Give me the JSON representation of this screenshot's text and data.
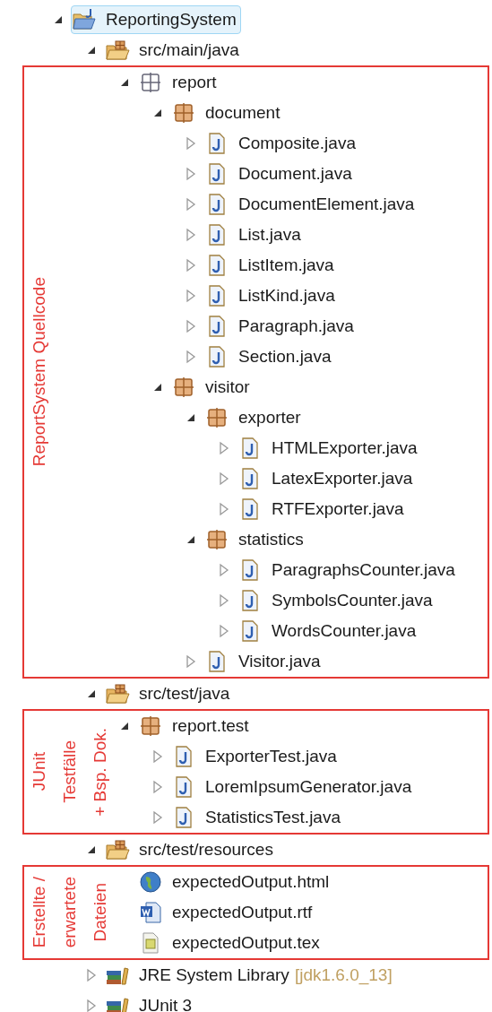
{
  "tree": [
    {
      "label": "ReportingSystem",
      "kind": "project",
      "expanded": true,
      "selected": true,
      "children": [
        {
          "label": "src/main/java",
          "kind": "source-folder",
          "expanded": true,
          "selected": false,
          "annotation": [
            "ReportSystem Quellcode"
          ],
          "children": [
            {
              "label": "report",
              "kind": "empty-package",
              "expanded": true,
              "selected": false,
              "children": [
                {
                  "label": "document",
                  "kind": "package",
                  "expanded": true,
                  "selected": false,
                  "children": [
                    {
                      "label": "Composite.java",
                      "kind": "java-file",
                      "expanded": false,
                      "selected": false
                    },
                    {
                      "label": "Document.java",
                      "kind": "java-file",
                      "expanded": false,
                      "selected": false
                    },
                    {
                      "label": "DocumentElement.java",
                      "kind": "java-file",
                      "expanded": false,
                      "selected": false
                    },
                    {
                      "label": "List.java",
                      "kind": "java-file",
                      "expanded": false,
                      "selected": false
                    },
                    {
                      "label": "ListItem.java",
                      "kind": "java-file",
                      "expanded": false,
                      "selected": false
                    },
                    {
                      "label": "ListKind.java",
                      "kind": "java-file",
                      "expanded": false,
                      "selected": false
                    },
                    {
                      "label": "Paragraph.java",
                      "kind": "java-file",
                      "expanded": false,
                      "selected": false
                    },
                    {
                      "label": "Section.java",
                      "kind": "java-file",
                      "expanded": false,
                      "selected": false
                    }
                  ]
                },
                {
                  "label": "visitor",
                  "kind": "package",
                  "expanded": true,
                  "selected": false,
                  "children": [
                    {
                      "label": "exporter",
                      "kind": "package",
                      "expanded": true,
                      "selected": false,
                      "children": [
                        {
                          "label": "HTMLExporter.java",
                          "kind": "java-file",
                          "expanded": false,
                          "selected": false
                        },
                        {
                          "label": "LatexExporter.java",
                          "kind": "java-file",
                          "expanded": false,
                          "selected": false
                        },
                        {
                          "label": "RTFExporter.java",
                          "kind": "java-file",
                          "expanded": false,
                          "selected": false
                        }
                      ]
                    },
                    {
                      "label": "statistics",
                      "kind": "package",
                      "expanded": true,
                      "selected": false,
                      "children": [
                        {
                          "label": "ParagraphsCounter.java",
                          "kind": "java-file",
                          "expanded": false,
                          "selected": false
                        },
                        {
                          "label": "SymbolsCounter.java",
                          "kind": "java-file",
                          "expanded": false,
                          "selected": false
                        },
                        {
                          "label": "WordsCounter.java",
                          "kind": "java-file",
                          "expanded": false,
                          "selected": false
                        }
                      ]
                    },
                    {
                      "label": "Visitor.java",
                      "kind": "java-file",
                      "expanded": false,
                      "selected": false
                    }
                  ]
                }
              ]
            }
          ]
        },
        {
          "label": "src/test/java",
          "kind": "source-folder",
          "expanded": true,
          "selected": false,
          "annotation": [
            "JUnit",
            "Testfälle",
            "+ Bsp. Dok."
          ],
          "children": [
            {
              "label": "report.test",
              "kind": "package",
              "expanded": true,
              "selected": false,
              "children": [
                {
                  "label": "ExporterTest.java",
                  "kind": "java-file",
                  "expanded": false,
                  "selected": false
                },
                {
                  "label": "LoremIpsumGenerator.java",
                  "kind": "java-file",
                  "expanded": false,
                  "selected": false
                },
                {
                  "label": "StatisticsTest.java",
                  "kind": "java-file",
                  "expanded": false,
                  "selected": false
                }
              ]
            }
          ]
        },
        {
          "label": "src/test/resources",
          "kind": "source-folder",
          "expanded": true,
          "selected": false,
          "annotation": [
            "Erstellte /",
            "erwartete",
            "Dateien"
          ],
          "children": [
            {
              "label": "expectedOutput.html",
              "kind": "html-file",
              "selected": false
            },
            {
              "label": "expectedOutput.rtf",
              "kind": "rtf-file",
              "selected": false
            },
            {
              "label": "expectedOutput.tex",
              "kind": "tex-file",
              "selected": false
            }
          ]
        },
        {
          "label": "JRE System Library",
          "decoration": "[jdk1.6.0_13]",
          "kind": "library",
          "expanded": false,
          "selected": false
        },
        {
          "label": "JUnit 3",
          "kind": "library",
          "expanded": false,
          "selected": false
        }
      ]
    }
  ]
}
